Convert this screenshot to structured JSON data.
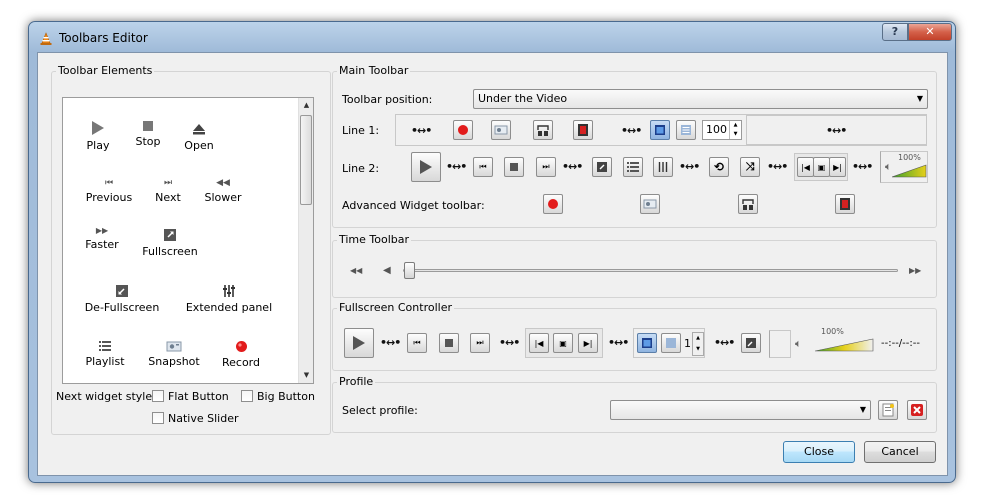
{
  "window": {
    "title": "Toolbars Editor",
    "help_label": "?",
    "close_label": "✕"
  },
  "elements": {
    "group_title": "Toolbar Elements",
    "items": [
      {
        "label": "Play",
        "icon": "play-icon"
      },
      {
        "label": "Stop",
        "icon": "stop-icon"
      },
      {
        "label": "Open",
        "icon": "eject-icon"
      },
      {
        "label": "Previous",
        "icon": "previous-icon"
      },
      {
        "label": "Next",
        "icon": "next-icon"
      },
      {
        "label": "Slower",
        "icon": "slower-icon"
      },
      {
        "label": "Faster",
        "icon": "faster-icon"
      },
      {
        "label": "Fullscreen",
        "icon": "fullscreen-icon"
      },
      {
        "label": "De-Fullscreen",
        "icon": "defullscreen-icon"
      },
      {
        "label": "Extended panel",
        "icon": "equalizer-icon"
      },
      {
        "label": "Playlist",
        "icon": "playlist-icon"
      },
      {
        "label": "Snapshot",
        "icon": "snapshot-icon"
      },
      {
        "label": "Record",
        "icon": "record-icon"
      }
    ],
    "widget_style_label": "Next widget style:",
    "flat_button": "Flat Button",
    "big_button": "Big Button",
    "native_slider": "Native Slider"
  },
  "main_toolbar": {
    "group_title": "Main Toolbar",
    "position_label": "Toolbar position:",
    "position_value": "Under the Video",
    "line1_label": "Line 1:",
    "line2_label": "Line 2:",
    "advanced_label": "Advanced Widget toolbar:",
    "spin_value": "100",
    "volume_percent": "100%"
  },
  "time_toolbar": {
    "group_title": "Time Toolbar"
  },
  "fullscreen": {
    "group_title": "Fullscreen Controller",
    "spin_value": "1",
    "volume_percent": "100%",
    "time_text": "--:--/--:--"
  },
  "profile": {
    "group_title": "Profile",
    "select_label": "Select profile:",
    "select_value": ""
  },
  "buttons": {
    "close": "Close",
    "cancel": "Cancel"
  },
  "colors": {
    "record_red": "#e21b1b",
    "window_frame": "#a8c2df",
    "default_button": "#bee6fd"
  }
}
